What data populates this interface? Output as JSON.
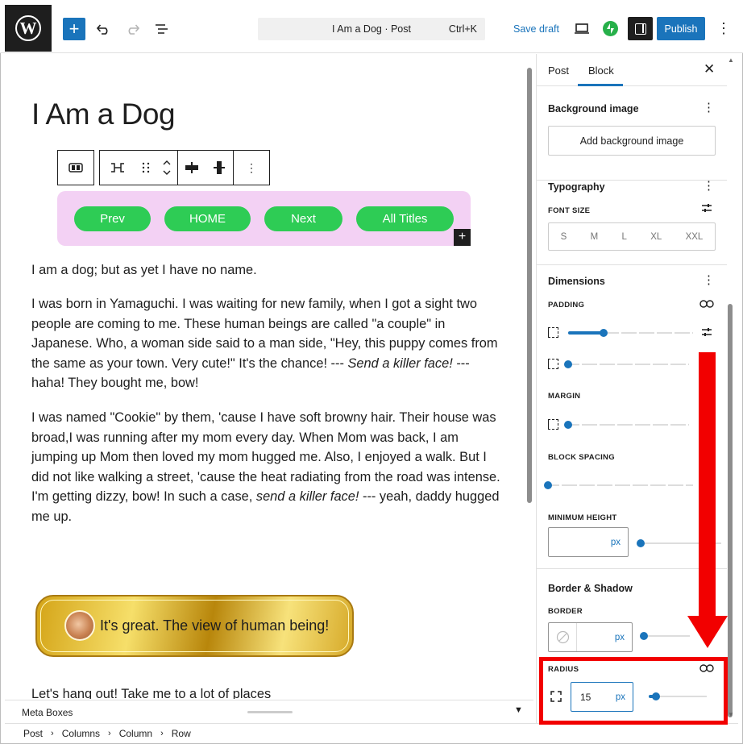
{
  "topbar": {
    "post_title_search": "I Am a Dog · Post",
    "shortcut": "Ctrl+K",
    "save_draft": "Save draft",
    "publish": "Publish"
  },
  "editor": {
    "post_title": "I Am a Dog",
    "nav_buttons": [
      "Prev",
      "HOME",
      "Next",
      "All Titles"
    ],
    "nav_bg_color": "#f3d1f4",
    "button_color": "#2ecc55",
    "paragraph1": "I am a dog; but as yet I have no name.",
    "paragraph2_part1": "I was born in Yamaguchi. I was waiting for new family, when I got a sight two people are coming to me. These human beings are called \"a couple\" in Japanese. Who, a woman side said to a man side, \"Hey, this puppy comes from the same as your town. Very cute!\" It's the chance! --- ",
    "paragraph2_em": "Send a killer face!",
    "paragraph2_part2": " --- haha! They bought me, bow!",
    "paragraph3_part1": "I was named \"Cookie\" by them, 'cause I have soft browny hair. Their house was broad,I was running after my mom every day. When Mom was back, I am jumping up Mom then loved my mom hugged me. Also, I enjoyed a walk. But I did not like walking a street, 'cause the heat radiating from the road was intense. I'm getting dizzy, bow! In such a case, ",
    "paragraph3_em": "send a killer face!",
    "paragraph3_part2": " --- yeah, daddy hugged me up.",
    "banner_text": "It's great. The view of human being!",
    "paragraph4": "Let's hang out! Take me to a lot of places"
  },
  "footer": {
    "meta_boxes": "Meta Boxes",
    "breadcrumbs": [
      "Post",
      "Columns",
      "Column",
      "Row"
    ]
  },
  "sidebar": {
    "tabs": [
      "Post",
      "Block"
    ],
    "active_tab": "Block",
    "background_image": {
      "title": "Background image",
      "button": "Add background image"
    },
    "typography": {
      "title": "Typography",
      "font_size_label": "FONT SIZE",
      "sizes": [
        "S",
        "M",
        "L",
        "XL",
        "XXL"
      ]
    },
    "dimensions": {
      "title": "Dimensions",
      "padding_label": "PADDING",
      "margin_label": "MARGIN",
      "block_spacing_label": "BLOCK SPACING",
      "min_height_label": "MINIMUM HEIGHT",
      "min_height_unit": "px"
    },
    "border_shadow": {
      "title": "Border & Shadow",
      "border_label": "BORDER",
      "border_unit": "px",
      "radius_label": "RADIUS",
      "radius_value": "15",
      "radius_unit": "px"
    }
  },
  "annotation_color": "#f20000"
}
